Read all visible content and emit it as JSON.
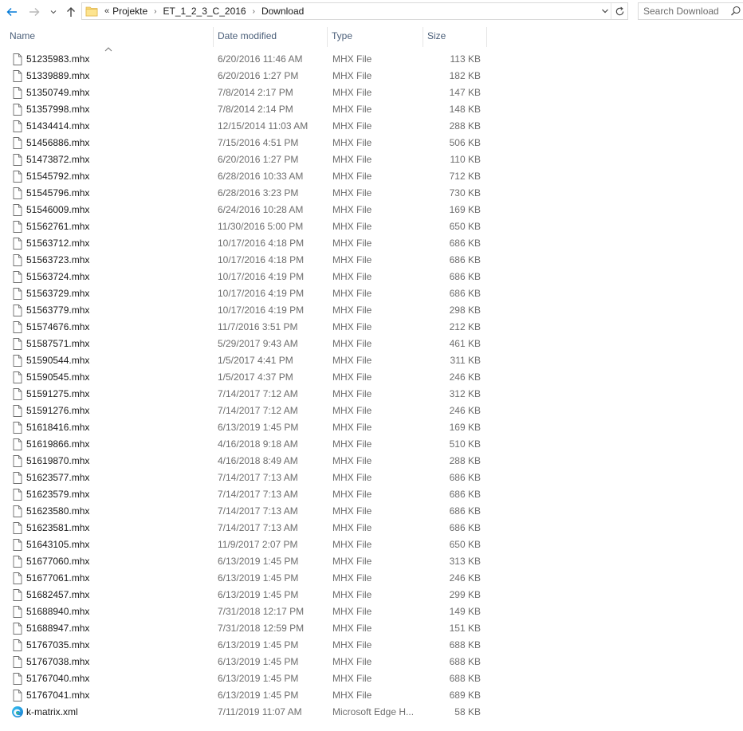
{
  "address_bar": {
    "overflow_label": "«",
    "breadcrumbs": [
      "Projekte",
      "ET_1_2_3_C_2016",
      "Download"
    ],
    "separator": "›"
  },
  "search": {
    "placeholder": "Search Download"
  },
  "columns": {
    "name": "Name",
    "date": "Date modified",
    "type": "Type",
    "size": "Size"
  },
  "files": [
    {
      "name": "51235983.mhx",
      "date": "6/20/2016 11:46 AM",
      "type": "MHX File",
      "size": "113 KB",
      "icon": "document-icon"
    },
    {
      "name": "51339889.mhx",
      "date": "6/20/2016 1:27 PM",
      "type": "MHX File",
      "size": "182 KB",
      "icon": "document-icon"
    },
    {
      "name": "51350749.mhx",
      "date": "7/8/2014 2:17 PM",
      "type": "MHX File",
      "size": "147 KB",
      "icon": "document-icon"
    },
    {
      "name": "51357998.mhx",
      "date": "7/8/2014 2:14 PM",
      "type": "MHX File",
      "size": "148 KB",
      "icon": "document-icon"
    },
    {
      "name": "51434414.mhx",
      "date": "12/15/2014 11:03 AM",
      "type": "MHX File",
      "size": "288 KB",
      "icon": "document-icon"
    },
    {
      "name": "51456886.mhx",
      "date": "7/15/2016 4:51 PM",
      "type": "MHX File",
      "size": "506 KB",
      "icon": "document-icon"
    },
    {
      "name": "51473872.mhx",
      "date": "6/20/2016 1:27 PM",
      "type": "MHX File",
      "size": "110 KB",
      "icon": "document-icon"
    },
    {
      "name": "51545792.mhx",
      "date": "6/28/2016 10:33 AM",
      "type": "MHX File",
      "size": "712 KB",
      "icon": "document-icon"
    },
    {
      "name": "51545796.mhx",
      "date": "6/28/2016 3:23 PM",
      "type": "MHX File",
      "size": "730 KB",
      "icon": "document-icon"
    },
    {
      "name": "51546009.mhx",
      "date": "6/24/2016 10:28 AM",
      "type": "MHX File",
      "size": "169 KB",
      "icon": "document-icon"
    },
    {
      "name": "51562761.mhx",
      "date": "11/30/2016 5:00 PM",
      "type": "MHX File",
      "size": "650 KB",
      "icon": "document-icon"
    },
    {
      "name": "51563712.mhx",
      "date": "10/17/2016 4:18 PM",
      "type": "MHX File",
      "size": "686 KB",
      "icon": "document-icon"
    },
    {
      "name": "51563723.mhx",
      "date": "10/17/2016 4:18 PM",
      "type": "MHX File",
      "size": "686 KB",
      "icon": "document-icon"
    },
    {
      "name": "51563724.mhx",
      "date": "10/17/2016 4:19 PM",
      "type": "MHX File",
      "size": "686 KB",
      "icon": "document-icon"
    },
    {
      "name": "51563729.mhx",
      "date": "10/17/2016 4:19 PM",
      "type": "MHX File",
      "size": "686 KB",
      "icon": "document-icon"
    },
    {
      "name": "51563779.mhx",
      "date": "10/17/2016 4:19 PM",
      "type": "MHX File",
      "size": "298 KB",
      "icon": "document-icon"
    },
    {
      "name": "51574676.mhx",
      "date": "11/7/2016 3:51 PM",
      "type": "MHX File",
      "size": "212 KB",
      "icon": "document-icon"
    },
    {
      "name": "51587571.mhx",
      "date": "5/29/2017 9:43 AM",
      "type": "MHX File",
      "size": "461 KB",
      "icon": "document-icon"
    },
    {
      "name": "51590544.mhx",
      "date": "1/5/2017 4:41 PM",
      "type": "MHX File",
      "size": "311 KB",
      "icon": "document-icon"
    },
    {
      "name": "51590545.mhx",
      "date": "1/5/2017 4:37 PM",
      "type": "MHX File",
      "size": "246 KB",
      "icon": "document-icon"
    },
    {
      "name": "51591275.mhx",
      "date": "7/14/2017 7:12 AM",
      "type": "MHX File",
      "size": "312 KB",
      "icon": "document-icon"
    },
    {
      "name": "51591276.mhx",
      "date": "7/14/2017 7:12 AM",
      "type": "MHX File",
      "size": "246 KB",
      "icon": "document-icon"
    },
    {
      "name": "51618416.mhx",
      "date": "6/13/2019 1:45 PM",
      "type": "MHX File",
      "size": "169 KB",
      "icon": "document-icon"
    },
    {
      "name": "51619866.mhx",
      "date": "4/16/2018 9:18 AM",
      "type": "MHX File",
      "size": "510 KB",
      "icon": "document-icon"
    },
    {
      "name": "51619870.mhx",
      "date": "4/16/2018 8:49 AM",
      "type": "MHX File",
      "size": "288 KB",
      "icon": "document-icon"
    },
    {
      "name": "51623577.mhx",
      "date": "7/14/2017 7:13 AM",
      "type": "MHX File",
      "size": "686 KB",
      "icon": "document-icon"
    },
    {
      "name": "51623579.mhx",
      "date": "7/14/2017 7:13 AM",
      "type": "MHX File",
      "size": "686 KB",
      "icon": "document-icon"
    },
    {
      "name": "51623580.mhx",
      "date": "7/14/2017 7:13 AM",
      "type": "MHX File",
      "size": "686 KB",
      "icon": "document-icon"
    },
    {
      "name": "51623581.mhx",
      "date": "7/14/2017 7:13 AM",
      "type": "MHX File",
      "size": "686 KB",
      "icon": "document-icon"
    },
    {
      "name": "51643105.mhx",
      "date": "11/9/2017 2:07 PM",
      "type": "MHX File",
      "size": "650 KB",
      "icon": "document-icon"
    },
    {
      "name": "51677060.mhx",
      "date": "6/13/2019 1:45 PM",
      "type": "MHX File",
      "size": "313 KB",
      "icon": "document-icon"
    },
    {
      "name": "51677061.mhx",
      "date": "6/13/2019 1:45 PM",
      "type": "MHX File",
      "size": "246 KB",
      "icon": "document-icon"
    },
    {
      "name": "51682457.mhx",
      "date": "6/13/2019 1:45 PM",
      "type": "MHX File",
      "size": "299 KB",
      "icon": "document-icon"
    },
    {
      "name": "51688940.mhx",
      "date": "7/31/2018 12:17 PM",
      "type": "MHX File",
      "size": "149 KB",
      "icon": "document-icon"
    },
    {
      "name": "51688947.mhx",
      "date": "7/31/2018 12:59 PM",
      "type": "MHX File",
      "size": "151 KB",
      "icon": "document-icon"
    },
    {
      "name": "51767035.mhx",
      "date": "6/13/2019 1:45 PM",
      "type": "MHX File",
      "size": "688 KB",
      "icon": "document-icon"
    },
    {
      "name": "51767038.mhx",
      "date": "6/13/2019 1:45 PM",
      "type": "MHX File",
      "size": "688 KB",
      "icon": "document-icon"
    },
    {
      "name": "51767040.mhx",
      "date": "6/13/2019 1:45 PM",
      "type": "MHX File",
      "size": "688 KB",
      "icon": "document-icon"
    },
    {
      "name": "51767041.mhx",
      "date": "6/13/2019 1:45 PM",
      "type": "MHX File",
      "size": "689 KB",
      "icon": "document-icon"
    },
    {
      "name": "k-matrix.xml",
      "date": "7/11/2019 11:07 AM",
      "type": "Microsoft Edge H...",
      "size": "58 KB",
      "icon": "edge-icon"
    }
  ],
  "colors": {
    "header_text": "#4c607a",
    "meta_text": "#6d6d6d",
    "accent": "#0078d7",
    "folder": "#f8d775"
  }
}
